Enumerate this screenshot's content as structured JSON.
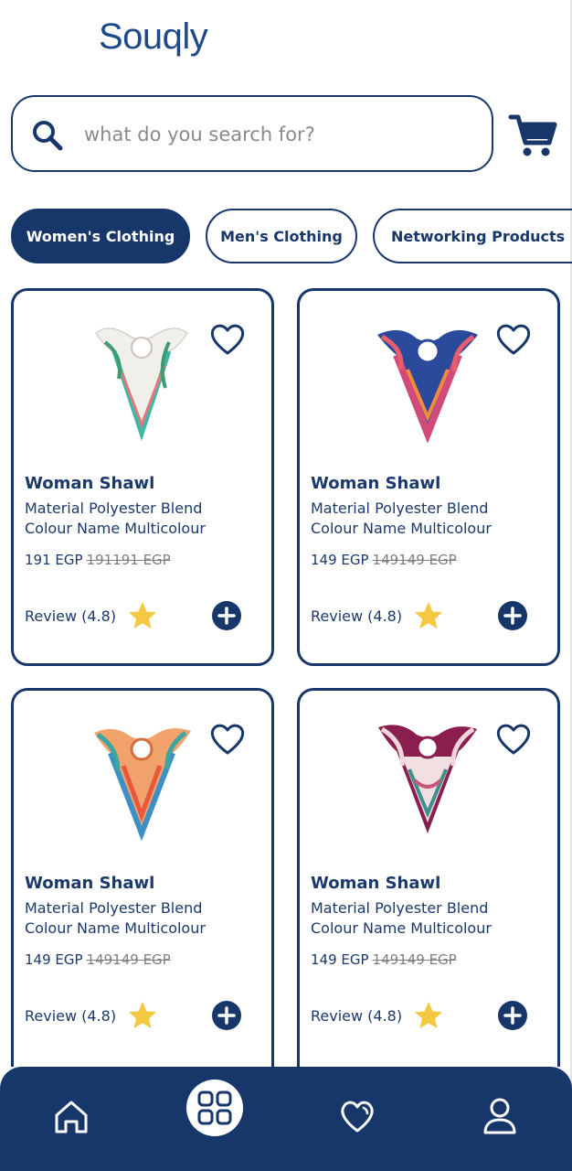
{
  "app": {
    "brand": "Souqly"
  },
  "search": {
    "placeholder": "what do you search for?",
    "value": ""
  },
  "categories": [
    {
      "label": "Women's Clothing",
      "active": true
    },
    {
      "label": "Men's Clothing",
      "active": false
    },
    {
      "label": "Networking Products",
      "active": false
    }
  ],
  "products": [
    {
      "title": "Woman Shawl",
      "material": "Material Polyester Blend",
      "colour": "Colour Name Multicolour",
      "price": "191 EGP",
      "old_price": "191191 EGP",
      "review": "Review (4.8)"
    },
    {
      "title": "Woman Shawl",
      "material": "Material Polyester Blend",
      "colour": "Colour Name Multicolour",
      "price": "149 EGP",
      "old_price": "149149 EGP",
      "review": "Review (4.8)"
    },
    {
      "title": "Woman Shawl",
      "material": "Material Polyester Blend",
      "colour": "Colour Name Multicolour",
      "price": "149 EGP",
      "old_price": "149149 EGP",
      "review": "Review (4.8)"
    },
    {
      "title": "Woman Shawl",
      "material": "Material Polyester Blend",
      "colour": "Colour Name Multicolour",
      "price": "149 EGP",
      "old_price": "149149 EGP",
      "review": "Review (4.8)"
    }
  ],
  "nav": {
    "items": [
      "home-icon",
      "grid-icon",
      "heart-icon",
      "user-icon"
    ],
    "active": "grid-icon"
  },
  "colors": {
    "primary": "#17376b",
    "star": "#f5c842",
    "background": "#ffffff"
  }
}
